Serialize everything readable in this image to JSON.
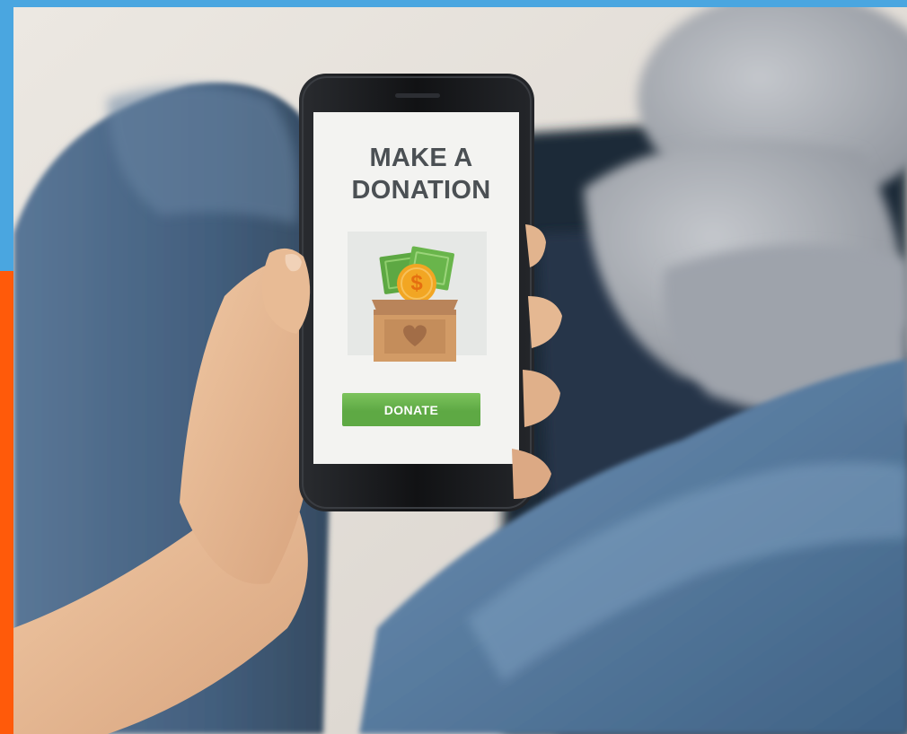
{
  "colors": {
    "frame_blue": "#4aa6e0",
    "frame_orange": "#ff5a0a",
    "wall": "#e6e1da",
    "sofa_dark": "#1f2a38",
    "cushion": "#a9adb4",
    "jeans_dark": "#3f5a78",
    "jeans_light": "#6d8fb2",
    "skin": "#e2b48e",
    "phone_body": "#151618",
    "screen": "#f3f3f1",
    "title_text": "#4b5054",
    "button_green": "#5ea944",
    "button_green_top": "#7cc35c",
    "box": "#d29b66",
    "box_dark": "#a7744b",
    "cash": "#69b54b",
    "coin": "#f2a623",
    "heart": "#a26d47"
  },
  "screen": {
    "title_line1": "MAKE A",
    "title_line2": "DONATION",
    "button_label": "DONATE"
  },
  "icons": {
    "illustration": "donation-box-icon",
    "coin": "dollar-coin-icon"
  },
  "coin_symbol": "$"
}
